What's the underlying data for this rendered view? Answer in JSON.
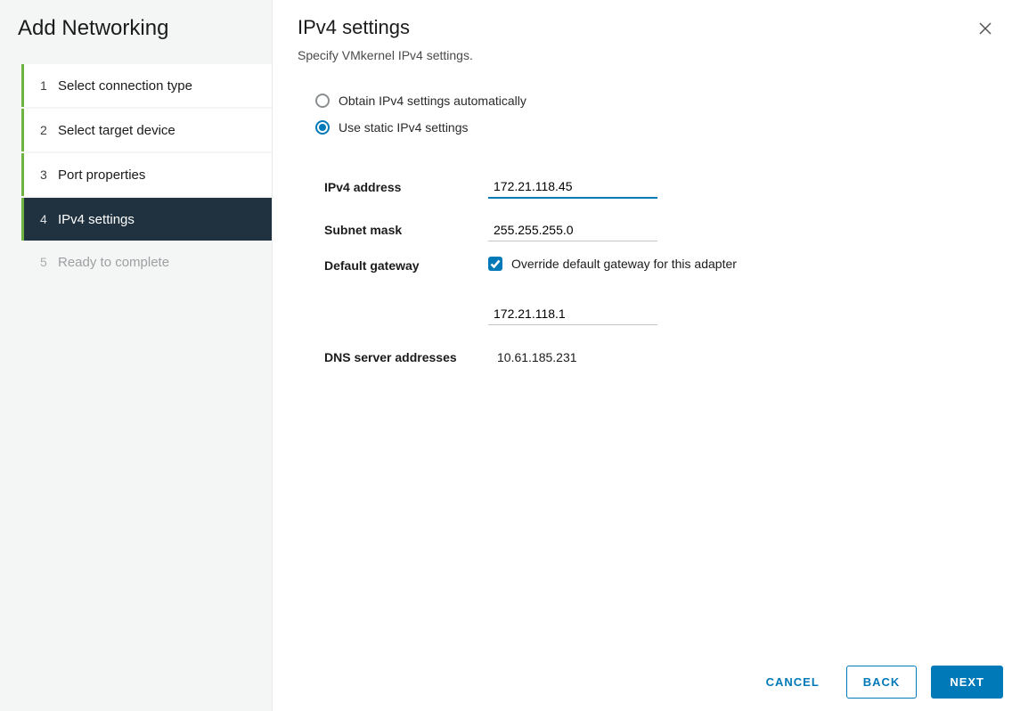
{
  "wizard": {
    "title": "Add Networking",
    "steps": [
      {
        "num": "1",
        "label": "Select connection type",
        "state": "done"
      },
      {
        "num": "2",
        "label": "Select target device",
        "state": "done"
      },
      {
        "num": "3",
        "label": "Port properties",
        "state": "done"
      },
      {
        "num": "4",
        "label": "IPv4 settings",
        "state": "current"
      },
      {
        "num": "5",
        "label": "Ready to complete",
        "state": "pending"
      }
    ]
  },
  "panel": {
    "title": "IPv4 settings",
    "subtitle": "Specify VMkernel IPv4 settings.",
    "radio_auto_label": "Obtain IPv4 settings automatically",
    "radio_static_label": "Use static IPv4 settings",
    "radio_selected": "static",
    "fields": {
      "ipv4_label": "IPv4 address",
      "ipv4_value": "172.21.118.45",
      "mask_label": "Subnet mask",
      "mask_value": "255.255.255.0",
      "gateway_label": "Default gateway",
      "override_label": "Override default gateway for this adapter",
      "override_checked": true,
      "gateway_value": "172.21.118.1",
      "dns_label": "DNS server addresses",
      "dns_value": "10.61.185.231"
    }
  },
  "footer": {
    "cancel": "CANCEL",
    "back": "BACK",
    "next": "NEXT"
  }
}
